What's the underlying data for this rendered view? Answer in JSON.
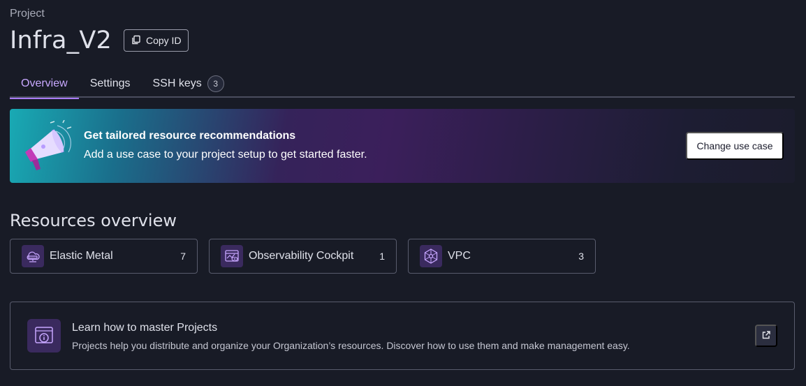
{
  "breadcrumb": "Project",
  "project": {
    "name": "Infra_V2",
    "copy_id_label": "Copy ID"
  },
  "tabs": [
    {
      "label": "Overview",
      "active": true
    },
    {
      "label": "Settings",
      "active": false
    },
    {
      "label": "SSH keys",
      "active": false,
      "count": "3"
    }
  ],
  "banner": {
    "title": "Get tailored resource recommendations",
    "text": "Add a use case to your project setup to get started faster.",
    "button_label": "Change use case",
    "icon": "megaphone-icon"
  },
  "resources": {
    "title": "Resources overview",
    "items": [
      {
        "label": "Elastic Metal",
        "count": "7",
        "icon": "elastic-metal-icon"
      },
      {
        "label": "Observability Cockpit",
        "count": "1",
        "icon": "cockpit-icon"
      },
      {
        "label": "VPC",
        "count": "3",
        "icon": "vpc-icon"
      }
    ]
  },
  "learn": {
    "title": "Learn how to master Projects",
    "text": "Projects help you distribute and organize your Organization’s resources. Discover how to use them and make management easy.",
    "icon": "info-window-icon",
    "link_icon": "external-link-icon"
  },
  "colors": {
    "background": "#181b26",
    "accent": "#a97bff",
    "icon_bg": "#3a2a5e"
  }
}
